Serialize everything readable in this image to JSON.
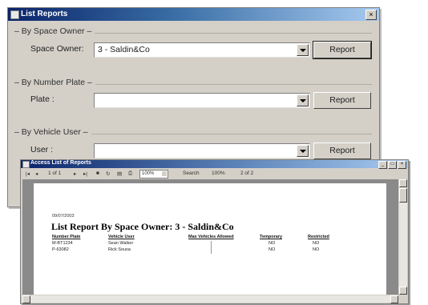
{
  "dialog": {
    "title": "List Reports",
    "close_glyph": "×",
    "groups": [
      {
        "legend": "By Space Owner",
        "label": "Space Owner:",
        "value": "3 - Saldin&Co",
        "button": "Report"
      },
      {
        "legend": "By Number Plate",
        "label": "Plate :",
        "value": "",
        "button": "Report"
      },
      {
        "legend": "By Vehicle User",
        "label": "User :",
        "value": "",
        "button": "Report"
      }
    ]
  },
  "viewer": {
    "title": "Access List of Reports",
    "window_buttons": [
      "_",
      "□",
      "×"
    ],
    "toolbar": {
      "page": "1 of 1",
      "zoom": "100%",
      "search": "Search",
      "percent": "100%",
      "counter": "2 of 2"
    },
    "report": {
      "date": "09/07/2003",
      "title": "List Report By Space Owner: 3 - Saldin&Co",
      "columns": [
        "Number Plate",
        "Vehicle User",
        "Max Vehicles Allowed",
        "Temporary",
        "Restricted"
      ],
      "rows": [
        [
          "M-BT1234",
          "Sean Walker",
          "",
          "NO",
          "NO"
        ],
        [
          "P-63082",
          "Rick Sousa",
          "",
          "NO",
          "NO"
        ]
      ]
    }
  }
}
